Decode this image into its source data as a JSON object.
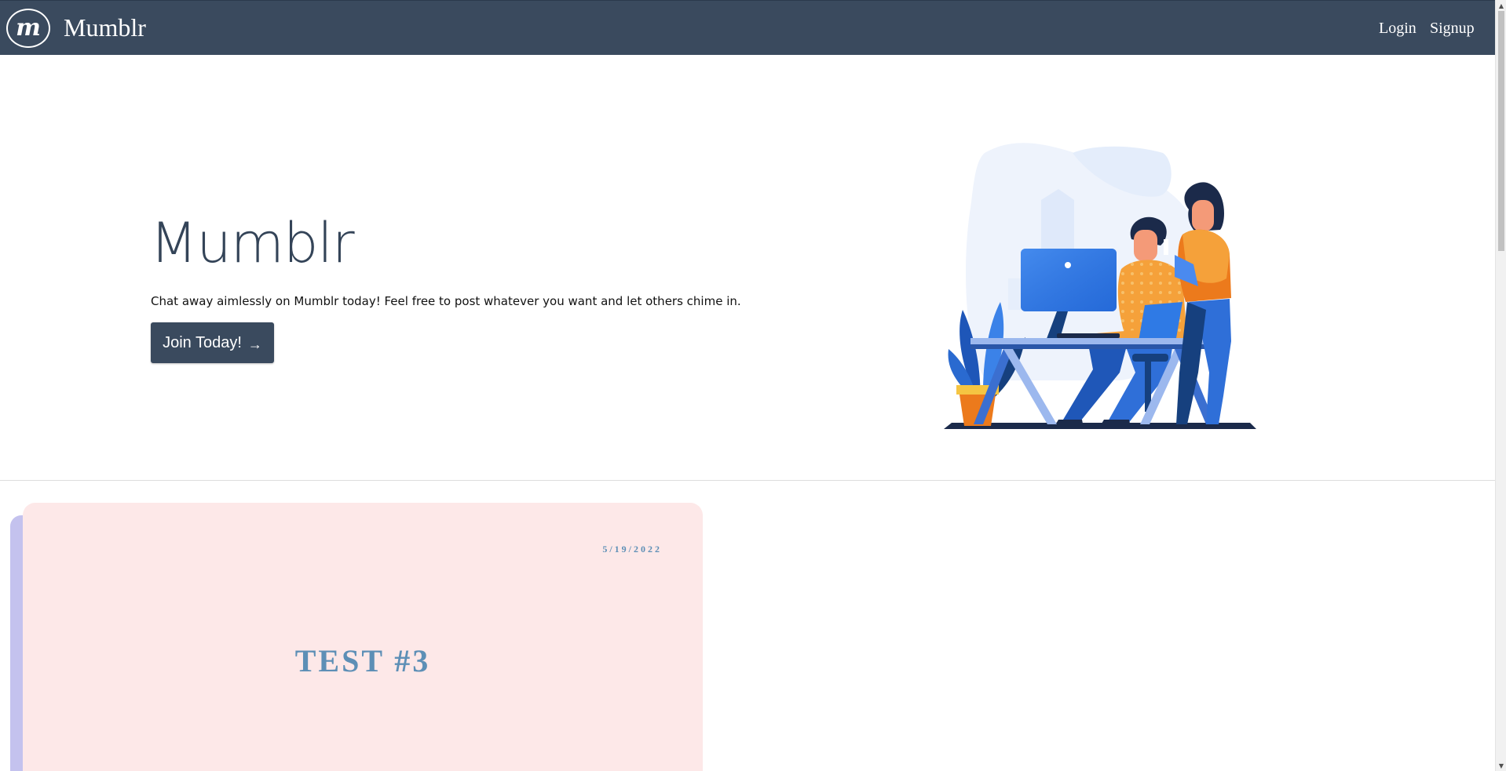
{
  "navbar": {
    "logo_letter": "m",
    "brand": "Mumblr",
    "login_label": "Login",
    "signup_label": "Signup",
    "background": "#3a4a5e"
  },
  "hero": {
    "title": "Mumblr",
    "description": "Chat away aimlessly on Mumblr today! Feel free to post whatever you want and let others chime in.",
    "join_label": "Join Today!",
    "join_arrow": "→",
    "illustration_icon": "people-at-computer-illustration"
  },
  "posts": [
    {
      "date": "5/19/2022",
      "title": "TEST #3",
      "background": "#fde8e8",
      "accent": "#5d8fb6"
    }
  ],
  "scrollbar": {
    "up_icon": "▲",
    "down_icon": "▼"
  }
}
